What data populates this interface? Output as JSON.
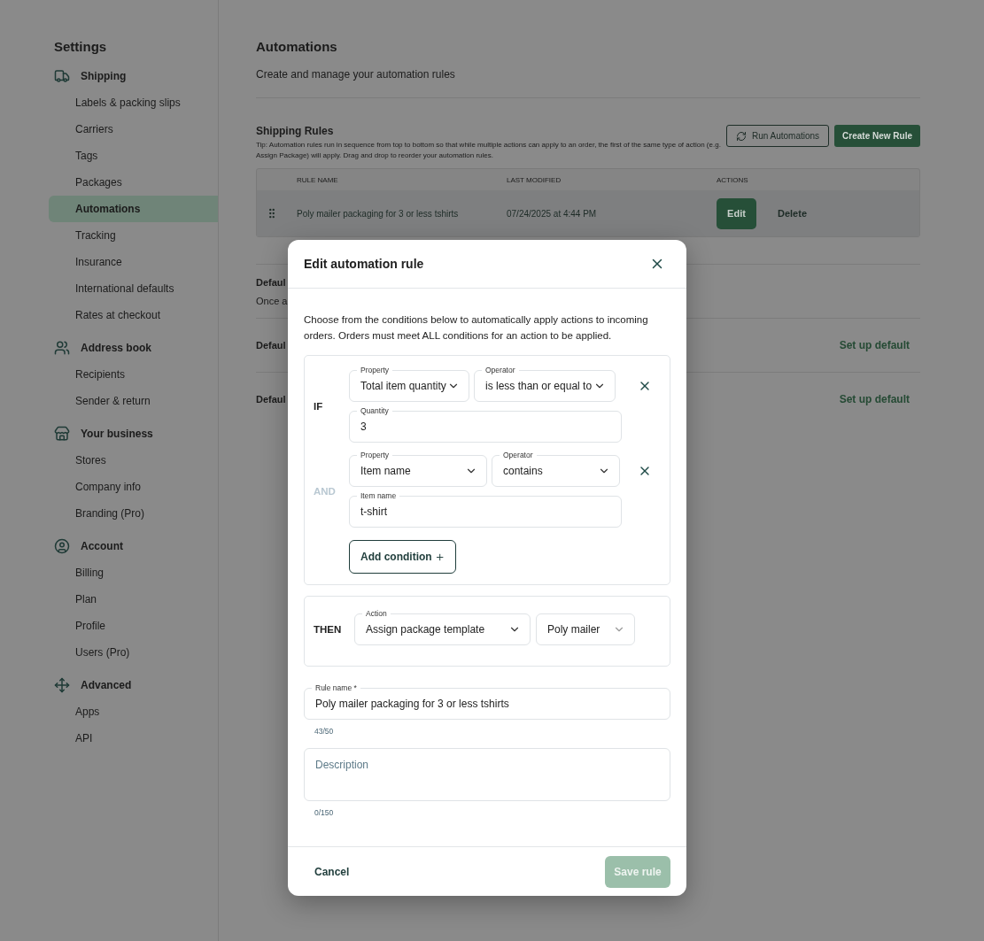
{
  "sidebar": {
    "title": "Settings",
    "groups": [
      {
        "label": "Shipping",
        "items": [
          {
            "label": "Labels & packing slips",
            "selected": false
          },
          {
            "label": "Carriers",
            "selected": false
          },
          {
            "label": "Tags",
            "selected": false
          },
          {
            "label": "Packages",
            "selected": false
          },
          {
            "label": "Automations",
            "selected": true
          },
          {
            "label": "Tracking",
            "selected": false
          },
          {
            "label": "Insurance",
            "selected": false
          },
          {
            "label": "International defaults",
            "selected": false
          },
          {
            "label": "Rates at checkout",
            "selected": false
          }
        ]
      },
      {
        "label": "Address book",
        "items": [
          {
            "label": "Recipients",
            "selected": false
          },
          {
            "label": "Sender & return",
            "selected": false
          }
        ]
      },
      {
        "label": "Your business",
        "items": [
          {
            "label": "Stores",
            "selected": false
          },
          {
            "label": "Company info",
            "selected": false
          },
          {
            "label": "Branding (Pro)",
            "selected": false
          }
        ]
      },
      {
        "label": "Account",
        "items": [
          {
            "label": "Billing",
            "selected": false
          },
          {
            "label": "Plan",
            "selected": false
          },
          {
            "label": "Profile",
            "selected": false
          },
          {
            "label": "Users (Pro)",
            "selected": false
          }
        ]
      },
      {
        "label": "Advanced",
        "items": [
          {
            "label": "Apps",
            "selected": false
          },
          {
            "label": "API",
            "selected": false
          }
        ]
      }
    ]
  },
  "main": {
    "title": "Automations",
    "subtitle": "Create and manage your automation rules",
    "rules": {
      "title": "Shipping Rules",
      "tip": "Tip: Automation rules run in sequence from top to bottom so that while multiple actions can apply to an order, the first of the same type of action (e.g. Assign Package) will apply. Drag and drop to reorder your automation rules.",
      "run_button": "Run Automations",
      "create_button": "Create New Rule",
      "columns": [
        "RULE NAME",
        "LAST MODIFIED",
        "ACTIONS"
      ],
      "rows": [
        {
          "rule_name": "Poly mailer packaging for 3 or less tshirts",
          "last_modified": "07/24/2025 at 4:44 PM",
          "edit": "Edit",
          "delete": "Delete"
        }
      ]
    },
    "defaults": [
      {
        "title": "Defaul",
        "text": "Once a"
      },
      {
        "title": "Defaul",
        "link": "Set up default"
      },
      {
        "title": "Defaul",
        "link": "Set up default"
      }
    ]
  },
  "modal": {
    "title": "Edit automation rule",
    "intro": "Choose from the conditions below to automatically apply actions to incoming orders. Orders must meet ALL conditions for an action to be applied.",
    "conditions": [
      {
        "connector": "IF",
        "muted": false,
        "property": {
          "label": "Property",
          "value": "Total item quantity"
        },
        "operator": {
          "label": "Operator",
          "value": "is less than or equal to"
        },
        "input": {
          "label": "Quantity",
          "value": "3"
        }
      },
      {
        "connector": "AND",
        "muted": true,
        "property": {
          "label": "Property",
          "value": "Item name"
        },
        "operator": {
          "label": "Operator",
          "value": "contains"
        },
        "input": {
          "label": "Item name",
          "value": "t-shirt"
        }
      }
    ],
    "add_condition": "Add condition",
    "then": {
      "connector": "THEN",
      "action": {
        "label": "Action",
        "value": "Assign package template"
      },
      "option": {
        "value": "Poly mailer"
      }
    },
    "rule_name": {
      "label": "Rule name *",
      "value": "Poly mailer packaging for 3 or less tshirts",
      "counter": "43/50"
    },
    "description": {
      "placeholder": "Description",
      "counter": "0/150"
    },
    "cancel": "Cancel",
    "save": {
      "label": "Save rule",
      "disabled": true
    }
  }
}
